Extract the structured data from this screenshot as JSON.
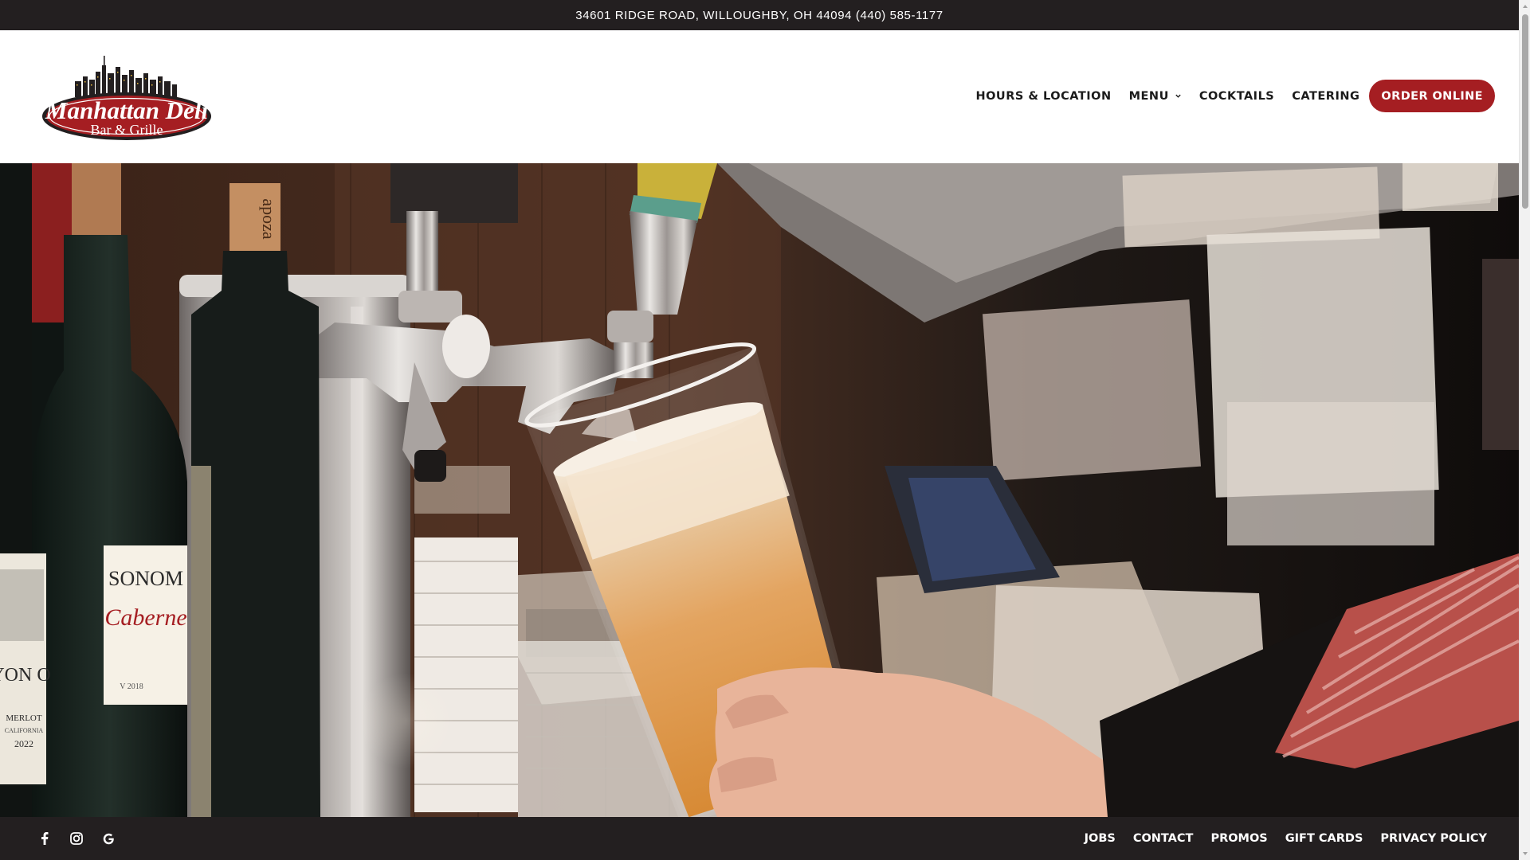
{
  "topbar": {
    "address": "34601 RIDGE ROAD, WILLOUGHBY, OH 44094 (440) 585-1177"
  },
  "logo": {
    "name": "Manhattan Deli",
    "subtitle": "Bar & Grille"
  },
  "nav": {
    "items": [
      {
        "label": "HOURS & LOCATION"
      },
      {
        "label": "MENU"
      },
      {
        "label": "COCKTAILS"
      },
      {
        "label": "CATERING"
      }
    ],
    "order_label": "ORDER ONLINE"
  },
  "hero": {
    "bottle_label_brand": "SONOM",
    "bottle_label_variety": "Caberne",
    "bottle_label_year": "V 2018",
    "left_bottle_label": "YON O",
    "left_bottle_wine": "MERLOT",
    "left_bottle_region": "CALIFORNIA",
    "left_bottle_year": "2022",
    "cork_text": "apoza"
  },
  "footer": {
    "social": [
      "facebook-icon",
      "instagram-icon",
      "google-icon"
    ],
    "links": [
      {
        "label": "JOBS"
      },
      {
        "label": "CONTACT"
      },
      {
        "label": "PROMOS"
      },
      {
        "label": "GIFT CARDS"
      },
      {
        "label": "PRIVACY POLICY"
      }
    ]
  },
  "colors": {
    "topbar_bg": "#231f20",
    "accent": "#a51e22",
    "text_dark": "#1b1b1b",
    "footer_bg": "#231f20"
  }
}
